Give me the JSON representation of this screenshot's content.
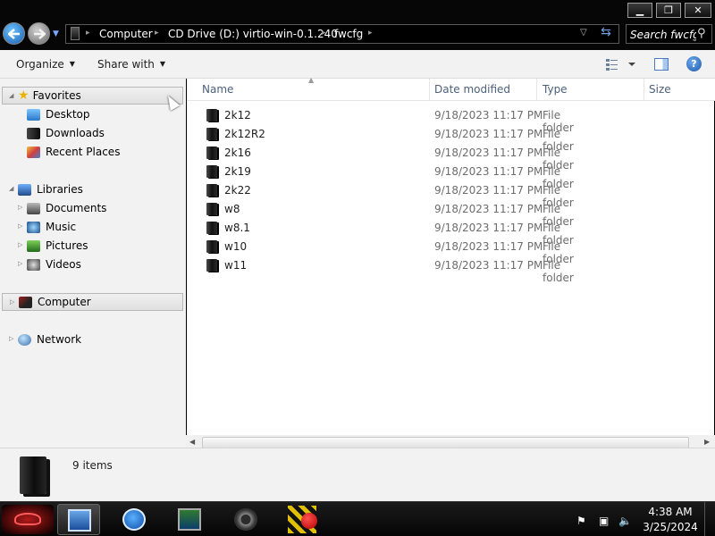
{
  "window": {
    "controls": {
      "minimize": "▁",
      "maximize": "❐",
      "close": "✕"
    }
  },
  "address": {
    "breadcrumbs": [
      "Computer",
      "CD Drive (D:) virtio-win-0.1.240",
      "fwcfg"
    ],
    "search_placeholder": "Search fwcfg"
  },
  "toolbar": {
    "organize_label": "Organize",
    "share_label": "Share with"
  },
  "sidebar": {
    "favorites": {
      "label": "Favorites",
      "items": [
        {
          "label": "Desktop",
          "icon": "desktop-icon"
        },
        {
          "label": "Downloads",
          "icon": "downloads-icon"
        },
        {
          "label": "Recent Places",
          "icon": "recent-places-icon"
        }
      ]
    },
    "libraries": {
      "label": "Libraries",
      "items": [
        {
          "label": "Documents",
          "icon": "documents-icon"
        },
        {
          "label": "Music",
          "icon": "music-icon"
        },
        {
          "label": "Pictures",
          "icon": "pictures-icon"
        },
        {
          "label": "Videos",
          "icon": "videos-icon"
        }
      ]
    },
    "computer_label": "Computer",
    "network_label": "Network"
  },
  "filelist": {
    "columns": [
      "Name",
      "Date modified",
      "Type",
      "Size"
    ],
    "rows": [
      {
        "name": "2k12",
        "date": "9/18/2023 11:17 PM",
        "type": "File folder"
      },
      {
        "name": "2k12R2",
        "date": "9/18/2023 11:17 PM",
        "type": "File folder"
      },
      {
        "name": "2k16",
        "date": "9/18/2023 11:17 PM",
        "type": "File folder"
      },
      {
        "name": "2k19",
        "date": "9/18/2023 11:17 PM",
        "type": "File folder"
      },
      {
        "name": "2k22",
        "date": "9/18/2023 11:17 PM",
        "type": "File folder"
      },
      {
        "name": "w8",
        "date": "9/18/2023 11:17 PM",
        "type": "File folder"
      },
      {
        "name": "w8.1",
        "date": "9/18/2023 11:17 PM",
        "type": "File folder"
      },
      {
        "name": "w10",
        "date": "9/18/2023 11:17 PM",
        "type": "File folder"
      },
      {
        "name": "w11",
        "date": "9/18/2023 11:17 PM",
        "type": "File folder"
      }
    ]
  },
  "details": {
    "item_count": "9 items"
  },
  "taskbar": {
    "time": "4:38 AM",
    "date": "3/25/2024"
  }
}
